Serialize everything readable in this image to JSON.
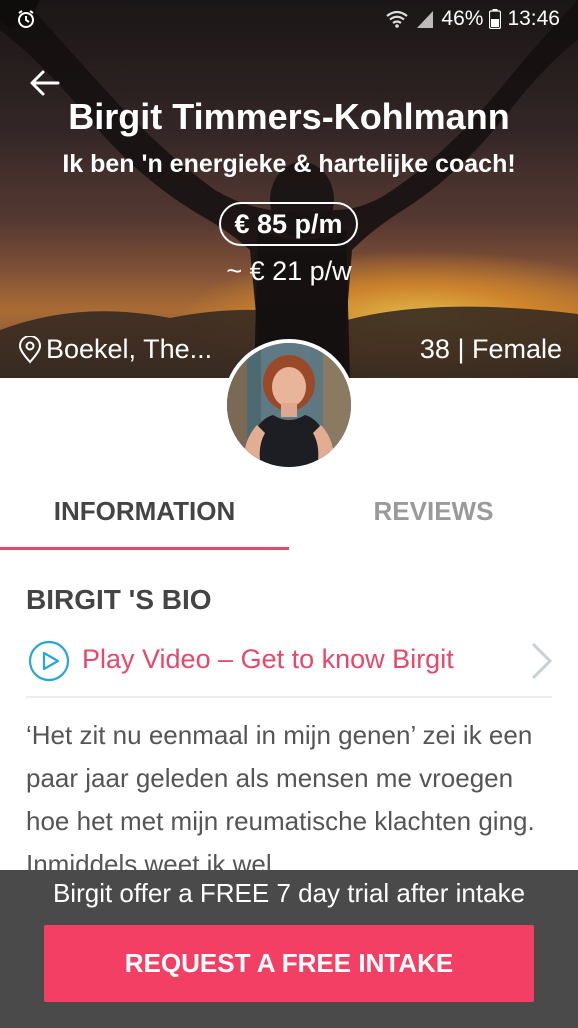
{
  "status_bar": {
    "battery_percent": "46%",
    "time": "13:46"
  },
  "profile": {
    "name": "Birgit Timmers-Kohlmann",
    "tagline": "Ik ben 'n energieke & hartelijke coach!",
    "price_month": "€ 85 p/m",
    "price_week": "~ € 21 p/w",
    "location": "Boekel, The...",
    "demographics": "38 | Female"
  },
  "tabs": [
    {
      "label": "INFORMATION",
      "active": true
    },
    {
      "label": "REVIEWS",
      "active": false
    }
  ],
  "bio": {
    "heading": "BIRGIT 'S BIO",
    "video_label": "Play Video – Get to know Birgit",
    "text": "‘Het zit nu eenmaal in mijn genen’ zei ik een paar jaar geleden als mensen me vroegen hoe het met mijn reumatische klachten ging. Inmiddels weet ik wel"
  },
  "footer": {
    "offer_text": "Birgit offer a FREE 7 day trial after intake",
    "cta_label": "REQUEST A FREE INTAKE"
  },
  "colors": {
    "accent": "#e8476a",
    "cta": "#f43f64",
    "play_icon": "#2aa6d6",
    "footer_bg": "#4a4a4a"
  },
  "icons": [
    "alarm-icon",
    "wifi-icon",
    "signal-icon",
    "battery-icon",
    "back-arrow-icon",
    "location-pin-icon",
    "play-circle-icon",
    "chevron-right-icon"
  ]
}
